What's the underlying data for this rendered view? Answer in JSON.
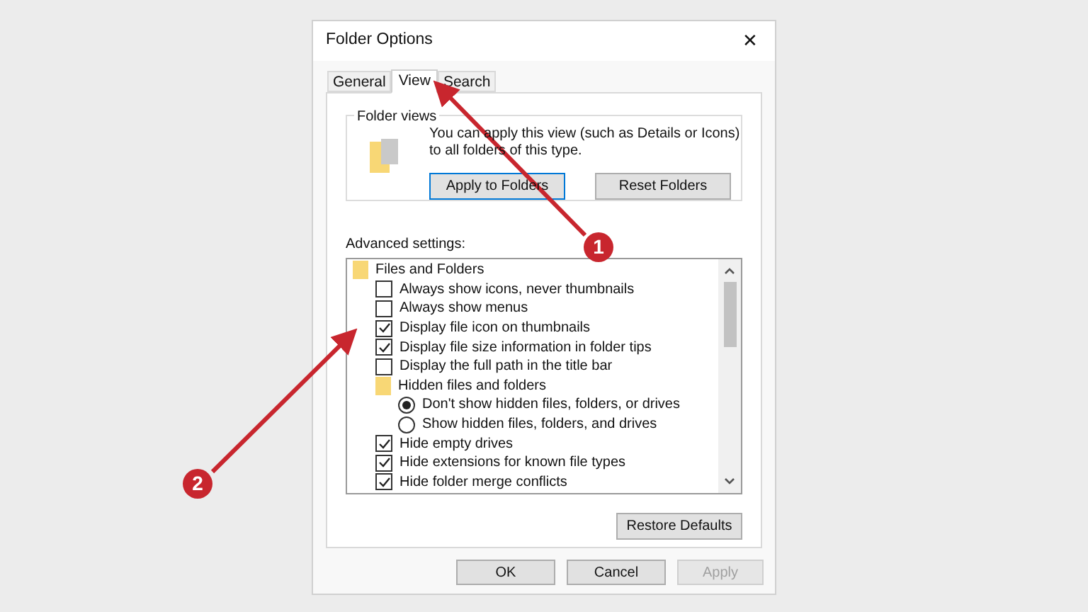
{
  "window": {
    "title": "Folder Options",
    "close": "✕"
  },
  "tabs": [
    {
      "label": "General",
      "selected": false
    },
    {
      "label": "View",
      "selected": true
    },
    {
      "label": "Search",
      "selected": false
    }
  ],
  "folder_views": {
    "title": "Folder views",
    "description": "You can apply this view (such as Details or Icons) to all folders of this type.",
    "buttons": [
      {
        "label": "Apply to Folders",
        "focused": true
      },
      {
        "label": "Reset Folders",
        "focused": false
      }
    ]
  },
  "advanced_settings": {
    "label": "Advanced settings:",
    "items": [
      {
        "kind": "folder",
        "label": "Files and Folders",
        "children": [
          {
            "kind": "checkbox",
            "label": "Always show icons, never thumbnails",
            "checked": false
          },
          {
            "kind": "checkbox",
            "label": "Always show menus",
            "checked": false
          },
          {
            "kind": "checkbox",
            "label": "Display file icon on thumbnails",
            "checked": true
          },
          {
            "kind": "checkbox",
            "label": "Display file size information in folder tips",
            "checked": true
          },
          {
            "kind": "checkbox",
            "label": "Display the full path in the title bar",
            "checked": false
          },
          {
            "kind": "folder",
            "label": "Hidden files and folders",
            "children": [
              {
                "kind": "radio",
                "label": "Don't show hidden files, folders, or drives",
                "selected": true
              },
              {
                "kind": "radio",
                "label": "Show hidden files, folders, and drives",
                "selected": false
              }
            ]
          },
          {
            "kind": "checkbox",
            "label": "Hide empty drives",
            "checked": true
          },
          {
            "kind": "checkbox",
            "label": "Hide extensions for known file types",
            "checked": true
          },
          {
            "kind": "checkbox",
            "label": "Hide folder merge conflicts",
            "checked": true
          }
        ]
      }
    ]
  },
  "restore_button": "Restore Defaults",
  "buttons": [
    {
      "label": "OK",
      "disabled": false
    },
    {
      "label": "Cancel",
      "disabled": false
    },
    {
      "label": "Apply",
      "disabled": true
    }
  ],
  "annotations": [
    "1",
    "2"
  ]
}
